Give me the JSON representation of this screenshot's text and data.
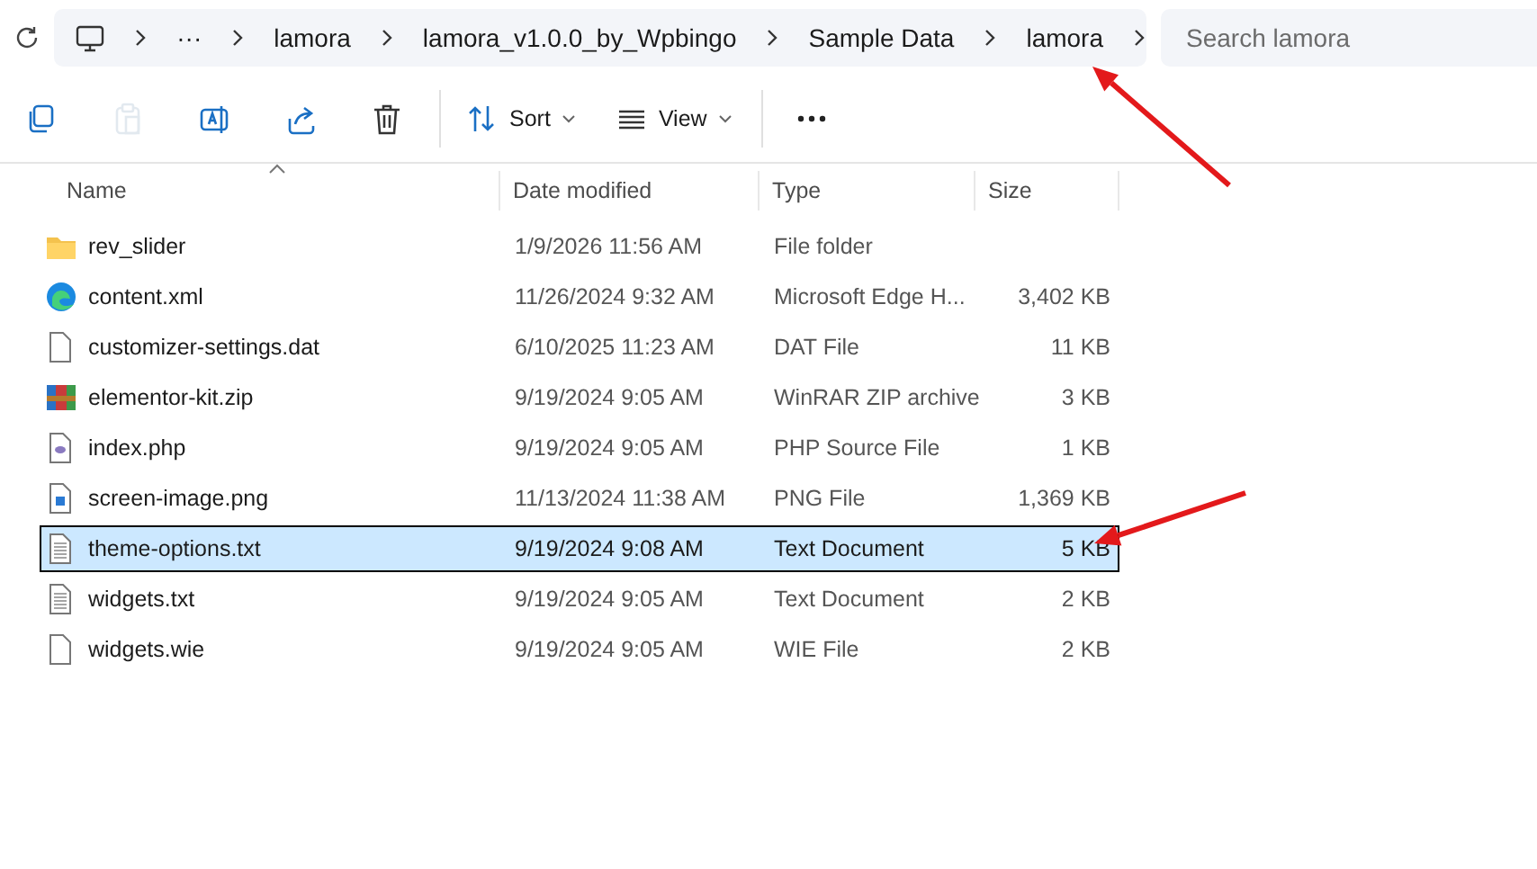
{
  "address_bar": {
    "overflow": "···",
    "crumbs": [
      "lamora",
      "lamora_v1.0.0_by_Wpbingo",
      "Sample Data",
      "lamora"
    ]
  },
  "search": {
    "placeholder": "Search lamora"
  },
  "toolbar": [
    {
      "kind": "copy",
      "disabled": false
    },
    {
      "kind": "paste",
      "disabled": true
    },
    {
      "kind": "rename",
      "disabled": false
    },
    {
      "kind": "share",
      "disabled": false
    },
    {
      "kind": "delete",
      "disabled": false
    },
    {
      "kind": "sort",
      "label": "Sort",
      "disabled": false
    },
    {
      "kind": "view",
      "label": "View",
      "disabled": false
    },
    {
      "kind": "more",
      "disabled": false
    }
  ],
  "table": {
    "columns": [
      "Name",
      "Date modified",
      "Type",
      "Size"
    ],
    "rows": [
      {
        "kind": "folder",
        "name": "rev_slider",
        "date": "1/9/2026 11:56 AM",
        "type": "File folder",
        "size": "",
        "selected": false
      },
      {
        "kind": "web",
        "name": "content.xml",
        "date": "11/26/2024 9:32 AM",
        "type": "Microsoft Edge H...",
        "size": "3,402 KB",
        "selected": false
      },
      {
        "kind": "file",
        "name": "customizer-settings.dat",
        "date": "6/10/2025 11:23 AM",
        "type": "DAT File",
        "size": "11 KB",
        "selected": false
      },
      {
        "kind": "archive",
        "name": "elementor-kit.zip",
        "date": "9/19/2024 9:05 AM",
        "type": "WinRAR ZIP archive",
        "size": "3 KB",
        "selected": false
      },
      {
        "kind": "script",
        "name": "index.php",
        "date": "9/19/2024 9:05 AM",
        "type": "PHP Source File",
        "size": "1 KB",
        "selected": false
      },
      {
        "kind": "image",
        "name": "screen-image.png",
        "date": "11/13/2024 11:38 AM",
        "type": "PNG File",
        "size": "1,369 KB",
        "selected": false
      },
      {
        "kind": "text",
        "name": "theme-options.txt",
        "date": "9/19/2024 9:08 AM",
        "type": "Text Document",
        "size": "5 KB",
        "selected": true
      },
      {
        "kind": "text",
        "name": "widgets.txt",
        "date": "9/19/2024 9:05 AM",
        "type": "Text Document",
        "size": "2 KB",
        "selected": false
      },
      {
        "kind": "file",
        "name": "widgets.wie",
        "date": "9/19/2024 9:05 AM",
        "type": "WIE File",
        "size": "2 KB",
        "selected": false
      }
    ]
  },
  "annotations": [
    {
      "kind": "arrow"
    },
    {
      "kind": "arrow"
    }
  ]
}
